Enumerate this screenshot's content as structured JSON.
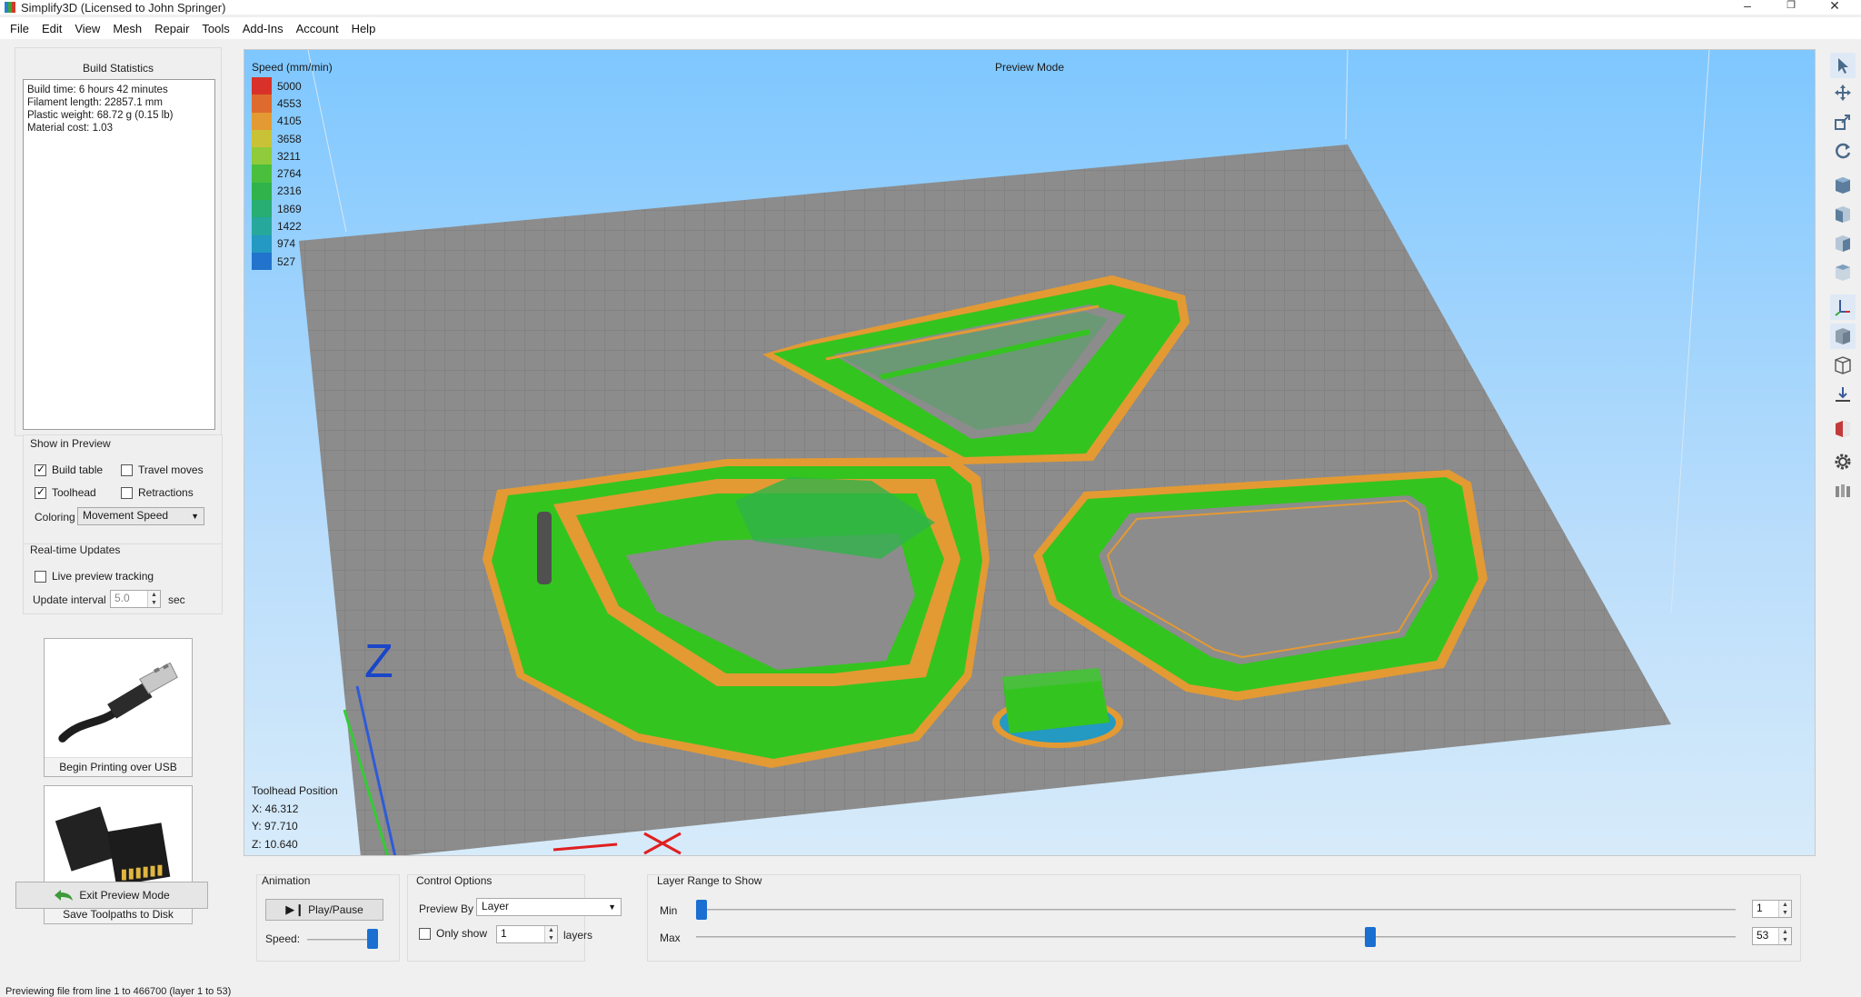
{
  "window": {
    "title": "Simplify3D (Licensed to John Springer)",
    "minimize_icon": "minimize-icon",
    "restore_icon": "restore-icon",
    "close_icon": "close-icon"
  },
  "menu": [
    "File",
    "Edit",
    "View",
    "Mesh",
    "Repair",
    "Tools",
    "Add-Ins",
    "Account",
    "Help"
  ],
  "build_statistics": {
    "title": "Build Statistics",
    "lines": [
      "Build time: 6 hours 42 minutes",
      "Filament length: 22857.1 mm",
      "Plastic weight: 68.72 g (0.15 lb)",
      "Material cost: 1.03"
    ]
  },
  "show_in_preview": {
    "title": "Show in Preview",
    "build_table": {
      "label": "Build table",
      "checked": true
    },
    "travel_moves": {
      "label": "Travel moves",
      "checked": false
    },
    "toolhead": {
      "label": "Toolhead",
      "checked": true
    },
    "retractions": {
      "label": "Retractions",
      "checked": false
    },
    "coloring_label": "Coloring",
    "coloring_value": "Movement Speed"
  },
  "realtime_updates": {
    "title": "Real-time Updates",
    "live_tracking": {
      "label": "Live preview tracking",
      "checked": false
    },
    "update_interval_label": "Update interval",
    "update_interval_value": "5.0",
    "update_interval_unit": "sec"
  },
  "actions": {
    "usb_label": "Begin Printing over USB",
    "sd_label": "Save Toolpaths to Disk",
    "exit_label": "Exit Preview Mode"
  },
  "viewport": {
    "mode_label": "Preview Mode",
    "legend_title": "Speed (mm/min)",
    "legend": [
      {
        "value": "5000",
        "color": "#d9312a"
      },
      {
        "value": "4553",
        "color": "#de6a2e"
      },
      {
        "value": "4105",
        "color": "#e39a33"
      },
      {
        "value": "3658",
        "color": "#c9c237"
      },
      {
        "value": "3211",
        "color": "#8fcb3a"
      },
      {
        "value": "2764",
        "color": "#49bf3d"
      },
      {
        "value": "2316",
        "color": "#2fb34a"
      },
      {
        "value": "1869",
        "color": "#28ad72"
      },
      {
        "value": "1422",
        "color": "#26a89c"
      },
      {
        "value": "974",
        "color": "#2499c2"
      },
      {
        "value": "527",
        "color": "#2273cc"
      }
    ],
    "toolhead_title": "Toolhead Position",
    "toolhead_x": "X: 46.312",
    "toolhead_y": "Y: 97.710",
    "toolhead_z": "Z: 10.640",
    "axis_z_label": "Z"
  },
  "right_toolbar": [
    "select-icon",
    "move-icon",
    "scale-icon",
    "rotate-icon",
    "view-top-icon",
    "view-front-icon",
    "view-side-icon",
    "view-iso-icon",
    "axes-icon",
    "solid-view-icon",
    "wireframe-icon",
    "ground-icon",
    "section-icon",
    "settings-gear-icon",
    "layers-icon"
  ],
  "animation": {
    "title": "Animation",
    "play_label": "Play/Pause",
    "speed_label": "Speed:",
    "speed_fraction": 1.0
  },
  "control_options": {
    "title": "Control Options",
    "preview_by_label": "Preview By",
    "preview_by_value": "Layer",
    "only_show_label": "Only show",
    "only_show_checked": false,
    "only_show_value": "1",
    "layers_label": "layers"
  },
  "layer_range": {
    "title": "Layer Range to Show",
    "min_label": "Min",
    "max_label": "Max",
    "min_value": "1",
    "max_value": "53",
    "min_fraction": 0.0,
    "max_fraction": 0.65
  },
  "status": "Previewing file from line 1 to 466700 (layer 1 to 53)"
}
